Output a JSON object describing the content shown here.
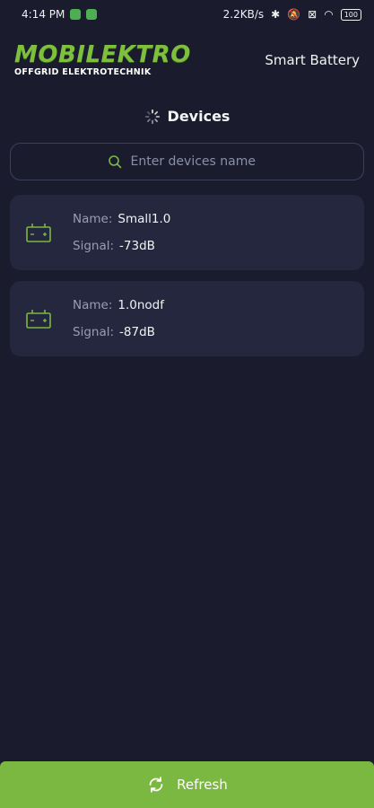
{
  "status_bar": {
    "time": "4:14 PM",
    "network_speed": "2.2KB/s",
    "battery_level": "100"
  },
  "header": {
    "logo_main": "MOBILEKTRO",
    "logo_sub": "OFFGRID ELEKTROTECHNIK",
    "title": "Smart Battery"
  },
  "section": {
    "title": "Devices"
  },
  "search": {
    "placeholder": "Enter devices name"
  },
  "devices": [
    {
      "name_label": "Name:",
      "name": "Small1.0",
      "signal_label": "Signal:",
      "signal": "-73dB"
    },
    {
      "name_label": "Name:",
      "name": "1.0nodf",
      "signal_label": "Signal:",
      "signal": "-87dB"
    }
  ],
  "footer": {
    "refresh_label": "Refresh"
  },
  "colors": {
    "accent": "#7bb841",
    "background": "#1a1c2e",
    "card": "#24273d"
  }
}
